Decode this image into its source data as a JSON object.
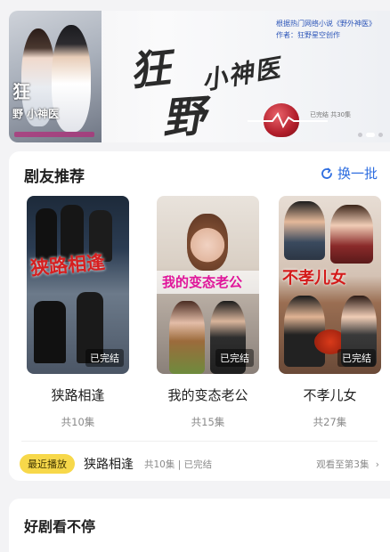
{
  "banner": {
    "poster_text_big": "狂",
    "poster_text_small": "野 小神医",
    "brush_1": "狂",
    "brush_2": "野",
    "brush_3": "小神医",
    "info_line_1": "根据热门网络小说《野外神医》",
    "info_line_2": "作者：狂野星空创作",
    "credit": "已完结 共30集",
    "page_count": 3,
    "active_index": 1
  },
  "recommend": {
    "title": "剧友推荐",
    "refresh_label": "换一批",
    "items": [
      {
        "name": "狭路相逢",
        "episodes": "共10集",
        "badge": "已完结",
        "cover_text": "狭路相逢"
      },
      {
        "name": "我的变态老公",
        "episodes": "共15集",
        "badge": "已完结",
        "cover_text": "我的变态老公"
      },
      {
        "name": "不孝儿女",
        "episodes": "共27集",
        "badge": "已完结",
        "cover_text": "不孝儿女"
      }
    ],
    "recent": {
      "tag": "最近播放",
      "title": "狭路相逢",
      "meta": "共10集 | 已完结",
      "progress": "观看至第3集",
      "arrow": "›"
    }
  },
  "section2": {
    "title": "好剧看不停"
  },
  "colors": {
    "accent": "#2d6de0",
    "tag_yellow": "#f7d84a",
    "background": "#f3f3f5"
  },
  "icons": [
    "refresh-icon",
    "chevron-right-icon"
  ]
}
